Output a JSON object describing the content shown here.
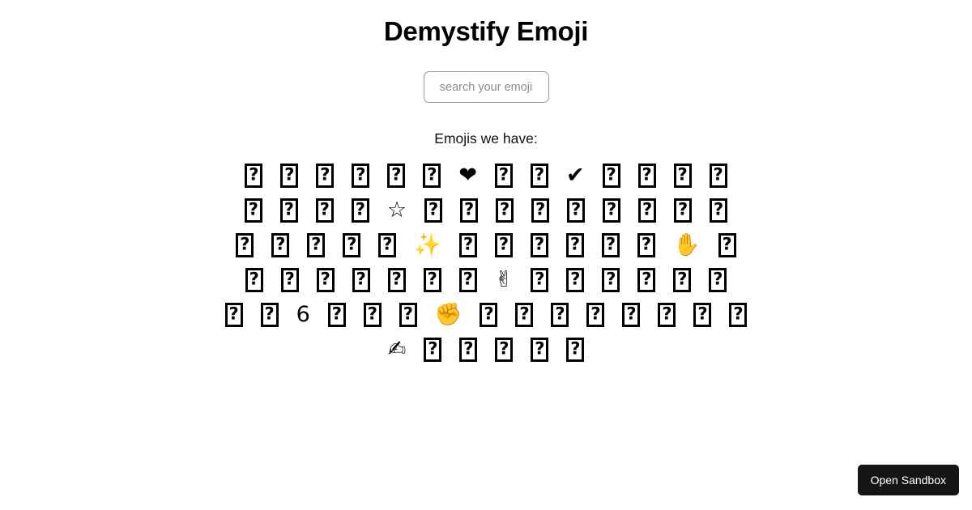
{
  "header": {
    "title": "Demystify Emoji"
  },
  "search": {
    "placeholder": "search your emoji",
    "value": ""
  },
  "emoji_section": {
    "heading": "Emojis we have:",
    "rows": [
      [
        {
          "kind": "tofu",
          "name": "emoji-tofu"
        },
        {
          "kind": "tofu",
          "name": "emoji-tofu"
        },
        {
          "kind": "tofu",
          "name": "emoji-tofu"
        },
        {
          "kind": "tofu",
          "name": "emoji-tofu"
        },
        {
          "kind": "tofu",
          "name": "emoji-tofu"
        },
        {
          "kind": "tofu",
          "name": "emoji-tofu"
        },
        {
          "kind": "glyph",
          "name": "black-heart-emoji",
          "char": "❤"
        },
        {
          "kind": "tofu",
          "name": "emoji-tofu"
        },
        {
          "kind": "tofu",
          "name": "emoji-tofu"
        },
        {
          "kind": "glyph",
          "name": "check-mark-emoji",
          "char": "✔"
        },
        {
          "kind": "tofu",
          "name": "emoji-tofu"
        },
        {
          "kind": "tofu",
          "name": "emoji-tofu"
        },
        {
          "kind": "tofu",
          "name": "emoji-tofu"
        },
        {
          "kind": "tofu",
          "name": "emoji-tofu"
        }
      ],
      [
        {
          "kind": "tofu",
          "name": "emoji-tofu"
        },
        {
          "kind": "tofu",
          "name": "emoji-tofu"
        },
        {
          "kind": "tofu",
          "name": "emoji-tofu"
        },
        {
          "kind": "tofu",
          "name": "emoji-tofu"
        },
        {
          "kind": "glyph",
          "name": "star-emoji",
          "char": "☆"
        },
        {
          "kind": "tofu",
          "name": "emoji-tofu"
        },
        {
          "kind": "tofu",
          "name": "emoji-tofu"
        },
        {
          "kind": "tofu",
          "name": "emoji-tofu"
        },
        {
          "kind": "tofu",
          "name": "emoji-tofu"
        },
        {
          "kind": "tofu",
          "name": "emoji-tofu"
        },
        {
          "kind": "tofu",
          "name": "emoji-tofu"
        },
        {
          "kind": "tofu",
          "name": "emoji-tofu"
        },
        {
          "kind": "tofu",
          "name": "emoji-tofu"
        },
        {
          "kind": "tofu",
          "name": "emoji-tofu"
        }
      ],
      [
        {
          "kind": "tofu",
          "name": "emoji-tofu"
        },
        {
          "kind": "tofu",
          "name": "emoji-tofu"
        },
        {
          "kind": "tofu",
          "name": "emoji-tofu"
        },
        {
          "kind": "tofu",
          "name": "emoji-tofu"
        },
        {
          "kind": "tofu",
          "name": "emoji-tofu"
        },
        {
          "kind": "glyph",
          "name": "sparkles-emoji",
          "char": "✨"
        },
        {
          "kind": "tofu",
          "name": "emoji-tofu"
        },
        {
          "kind": "tofu",
          "name": "emoji-tofu"
        },
        {
          "kind": "tofu",
          "name": "emoji-tofu"
        },
        {
          "kind": "tofu",
          "name": "emoji-tofu"
        },
        {
          "kind": "tofu",
          "name": "emoji-tofu"
        },
        {
          "kind": "tofu",
          "name": "emoji-tofu"
        },
        {
          "kind": "glyph",
          "name": "raised-hand-emoji",
          "char": "✋"
        },
        {
          "kind": "tofu",
          "name": "emoji-tofu"
        }
      ],
      [
        {
          "kind": "tofu",
          "name": "emoji-tofu"
        },
        {
          "kind": "tofu",
          "name": "emoji-tofu"
        },
        {
          "kind": "tofu",
          "name": "emoji-tofu"
        },
        {
          "kind": "tofu",
          "name": "emoji-tofu"
        },
        {
          "kind": "tofu",
          "name": "emoji-tofu"
        },
        {
          "kind": "tofu",
          "name": "emoji-tofu"
        },
        {
          "kind": "tofu",
          "name": "emoji-tofu"
        },
        {
          "kind": "glyph",
          "name": "victory-hand-emoji",
          "char": "✌"
        },
        {
          "kind": "tofu",
          "name": "emoji-tofu"
        },
        {
          "kind": "tofu",
          "name": "emoji-tofu"
        },
        {
          "kind": "tofu",
          "name": "emoji-tofu"
        },
        {
          "kind": "tofu",
          "name": "emoji-tofu"
        },
        {
          "kind": "tofu",
          "name": "emoji-tofu"
        },
        {
          "kind": "tofu",
          "name": "emoji-tofu"
        }
      ],
      [
        {
          "kind": "tofu",
          "name": "emoji-tofu"
        },
        {
          "kind": "tofu",
          "name": "emoji-tofu"
        },
        {
          "kind": "glyph",
          "name": "bar-chart-emoji",
          "char": "὏6"
        },
        {
          "kind": "tofu",
          "name": "emoji-tofu"
        },
        {
          "kind": "tofu",
          "name": "emoji-tofu"
        },
        {
          "kind": "tofu",
          "name": "emoji-tofu"
        },
        {
          "kind": "glyph",
          "name": "raised-fist-emoji",
          "char": "✊"
        },
        {
          "kind": "tofu",
          "name": "emoji-tofu"
        },
        {
          "kind": "tofu",
          "name": "emoji-tofu"
        },
        {
          "kind": "tofu",
          "name": "emoji-tofu"
        },
        {
          "kind": "tofu",
          "name": "emoji-tofu"
        },
        {
          "kind": "tofu",
          "name": "emoji-tofu"
        },
        {
          "kind": "tofu",
          "name": "emoji-tofu"
        },
        {
          "kind": "tofu",
          "name": "emoji-tofu"
        },
        {
          "kind": "tofu",
          "name": "emoji-tofu"
        }
      ],
      [
        {
          "kind": "glyph",
          "name": "writing-hand-emoji",
          "char": "✍"
        },
        {
          "kind": "tofu",
          "name": "emoji-tofu"
        },
        {
          "kind": "tofu",
          "name": "emoji-tofu"
        },
        {
          "kind": "tofu",
          "name": "emoji-tofu"
        },
        {
          "kind": "tofu",
          "name": "emoji-tofu"
        },
        {
          "kind": "tofu",
          "name": "emoji-tofu"
        }
      ]
    ]
  },
  "sandbox": {
    "label": "Open Sandbox"
  },
  "colors": {
    "background": "#ffffff",
    "text": "#000000",
    "placeholder": "#8b8b8b",
    "input_border": "#9a9a9a",
    "sandbox_bg": "#151515",
    "sandbox_text": "#ffffff"
  }
}
